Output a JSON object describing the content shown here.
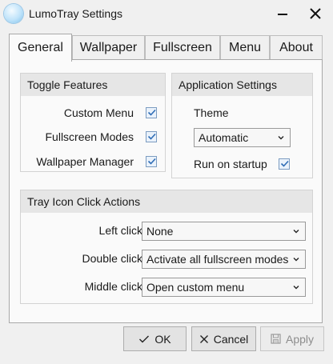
{
  "window": {
    "title": "LumoTray Settings"
  },
  "tabs": [
    {
      "label": "General",
      "active": true
    },
    {
      "label": "Wallpaper"
    },
    {
      "label": "Fullscreen"
    },
    {
      "label": "Menu"
    },
    {
      "label": "About"
    }
  ],
  "toggle_features": {
    "heading": "Toggle Features",
    "items": [
      {
        "label": "Custom Menu",
        "checked": true
      },
      {
        "label": "Fullscreen Modes",
        "checked": true
      },
      {
        "label": "Wallpaper Manager",
        "checked": true
      }
    ]
  },
  "app_settings": {
    "heading": "Application Settings",
    "theme_label": "Theme",
    "theme_value": "Automatic",
    "startup_label": "Run on startup",
    "startup_checked": true
  },
  "tray_actions": {
    "heading": "Tray Icon Click Actions",
    "rows": [
      {
        "label": "Left click",
        "value": "None"
      },
      {
        "label": "Double click",
        "value": "Activate all fullscreen modes"
      },
      {
        "label": "Middle click",
        "value": "Open custom menu"
      }
    ]
  },
  "buttons": {
    "ok": "OK",
    "cancel": "Cancel",
    "apply": "Apply",
    "apply_enabled": false
  },
  "colors": {
    "accent": "#2f6db6",
    "checkbox_border": "#7c9cc1"
  }
}
